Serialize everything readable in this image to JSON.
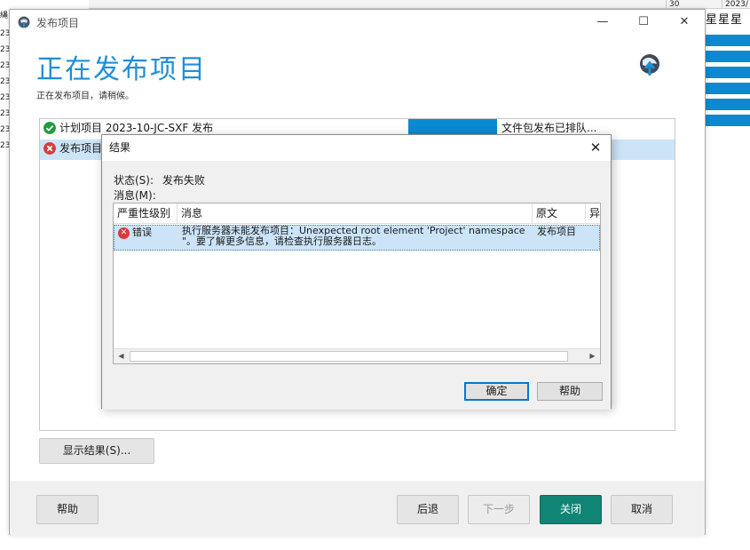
{
  "background": {
    "left_rows": [
      "縄",
      "23",
      "23",
      "23",
      "23",
      "23",
      "23",
      "23",
      "23"
    ],
    "top_cells": [
      "30",
      "2023/"
    ],
    "right_header": "星星星"
  },
  "window": {
    "title": "发布项目",
    "controls": {
      "minimize": "—",
      "maximize": "☐",
      "close": "✕"
    },
    "heading": "正在发布项目",
    "subheading": "正在发布项目，请稍候。"
  },
  "tasks": [
    {
      "icon": "success",
      "name": "计划项目 2023-10-JC-SXF 发布",
      "status": "文件包发布已排队..."
    },
    {
      "icon": "error",
      "name": "发布项目",
      "status": ""
    }
  ],
  "buttons": {
    "show_results": "显示结果(S)...",
    "help": "帮助",
    "back": "后退",
    "next": "下一步",
    "close": "关闭",
    "cancel": "取消"
  },
  "dialog": {
    "title": "结果",
    "status_label": "状态(S):",
    "status_value": "发布失败",
    "messages_label": "消息(M):",
    "columns": [
      "严重性级别",
      "消息",
      "原文",
      "异"
    ],
    "rows": [
      {
        "severity": "错误",
        "message": "执行服务器未能发布项目：Unexpected root element 'Project' namespace \"。要了解更多信息，请检查执行服务器日志。",
        "source": "发布项目",
        "exception": ""
      }
    ],
    "ok": "确定",
    "help": "帮助"
  },
  "colors": {
    "accent": "#1f8fd6",
    "progress": "#0a8ad3",
    "primary_button": "#108575",
    "selection": "#cce4f7",
    "error": "#d93a3a",
    "success": "#1e9c3c"
  }
}
